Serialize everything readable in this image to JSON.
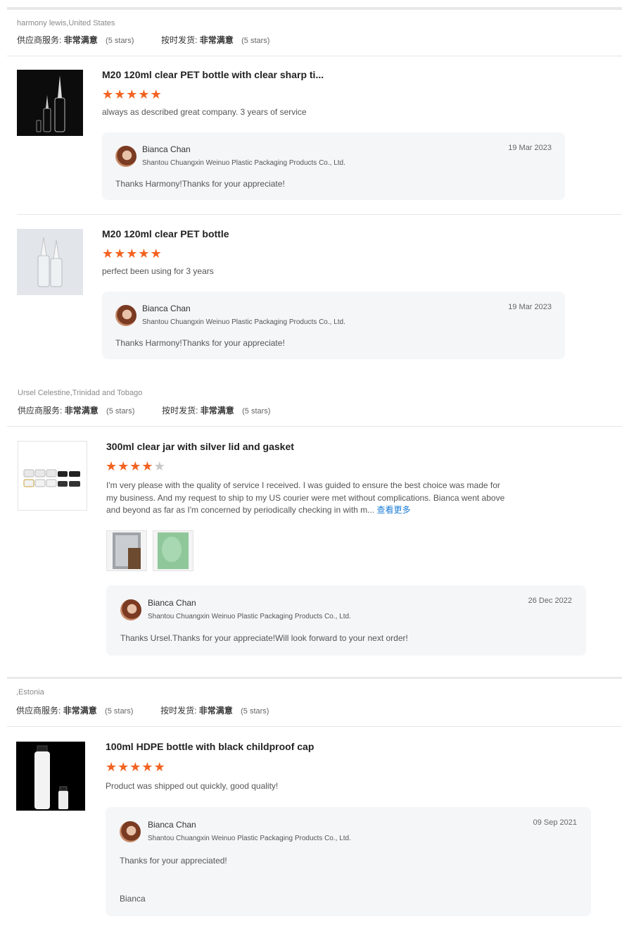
{
  "colors": {
    "star": "#f26322",
    "star_off": "#c8c8c8",
    "link": "#1a7cd6",
    "reply_bg": "#f5f6f8"
  },
  "icons": {
    "star": "star-icon",
    "avatar": "avatar"
  },
  "reviewers": [
    {
      "buyer": "harmony lewis,United States",
      "supplier_label": "供应商服务:",
      "supplier_value": "非常满意",
      "supplier_stars": "(5 stars)",
      "shipping_label": "按时发货:",
      "shipping_value": "非常满意",
      "shipping_stars": "(5 stars)",
      "products": [
        {
          "title": "M20 120ml clear PET bottle with clear sharp ti...",
          "rating": 5,
          "comment": "always as described great company. 3 years of service",
          "reply": {
            "name": "Bianca Chan",
            "company": "Shantou Chuangxin Weinuo Plastic Packaging Products Co., Ltd.",
            "date": "19 Mar 2023",
            "text": "Thanks Harmony!Thanks for your appreciate!"
          }
        },
        {
          "title": "M20 120ml clear PET bottle",
          "rating": 5,
          "comment": "perfect been using for 3 years",
          "reply": {
            "name": "Bianca Chan",
            "company": "Shantou Chuangxin Weinuo Plastic Packaging Products Co., Ltd.",
            "date": "19 Mar 2023",
            "text": "Thanks Harmony!Thanks for your appreciate!"
          }
        }
      ]
    },
    {
      "buyer": "Ursel Celestine,Trinidad and Tobago",
      "supplier_label": "供应商服务:",
      "supplier_value": "非常满意",
      "supplier_stars": "(5 stars)",
      "shipping_label": "按时发货:",
      "shipping_value": "非常满意",
      "shipping_stars": "(5 stars)",
      "products": [
        {
          "title": "300ml clear jar with silver lid and gasket",
          "rating": 4,
          "comment_lines": [
            "I'm very please with the quality of service I received. I was guided to ensure the best choice was made for",
            "my business. And my request to ship to my US courier were met without complications. Bianca went above",
            "and beyond as far as I'm concerned by periodically checking in with m..."
          ],
          "more_label": "查看更多",
          "reply": {
            "name": "Bianca Chan",
            "company": "Shantou Chuangxin Weinuo Plastic Packaging Products Co., Ltd.",
            "date": "26 Dec 2022",
            "text": "Thanks Ursel.Thanks for your appreciate!Will look forward to your next order!"
          }
        }
      ]
    },
    {
      "buyer": ",Estonia",
      "supplier_label": "供应商服务:",
      "supplier_value": "非常满意",
      "supplier_stars": "(5 stars)",
      "shipping_label": "按时发货:",
      "shipping_value": "非常满意",
      "shipping_stars": "(5 stars)",
      "products": [
        {
          "title": "100ml HDPE bottle with black childproof cap",
          "rating": 5,
          "comment": "Product was shipped out quickly, good quality!",
          "reply": {
            "name": "Bianca Chan",
            "company": "Shantou Chuangxin Weinuo Plastic Packaging Products Co., Ltd.",
            "date": "09 Sep 2021",
            "text": "Thanks for your appreciated!",
            "signature": "Bianca"
          }
        }
      ]
    }
  ]
}
